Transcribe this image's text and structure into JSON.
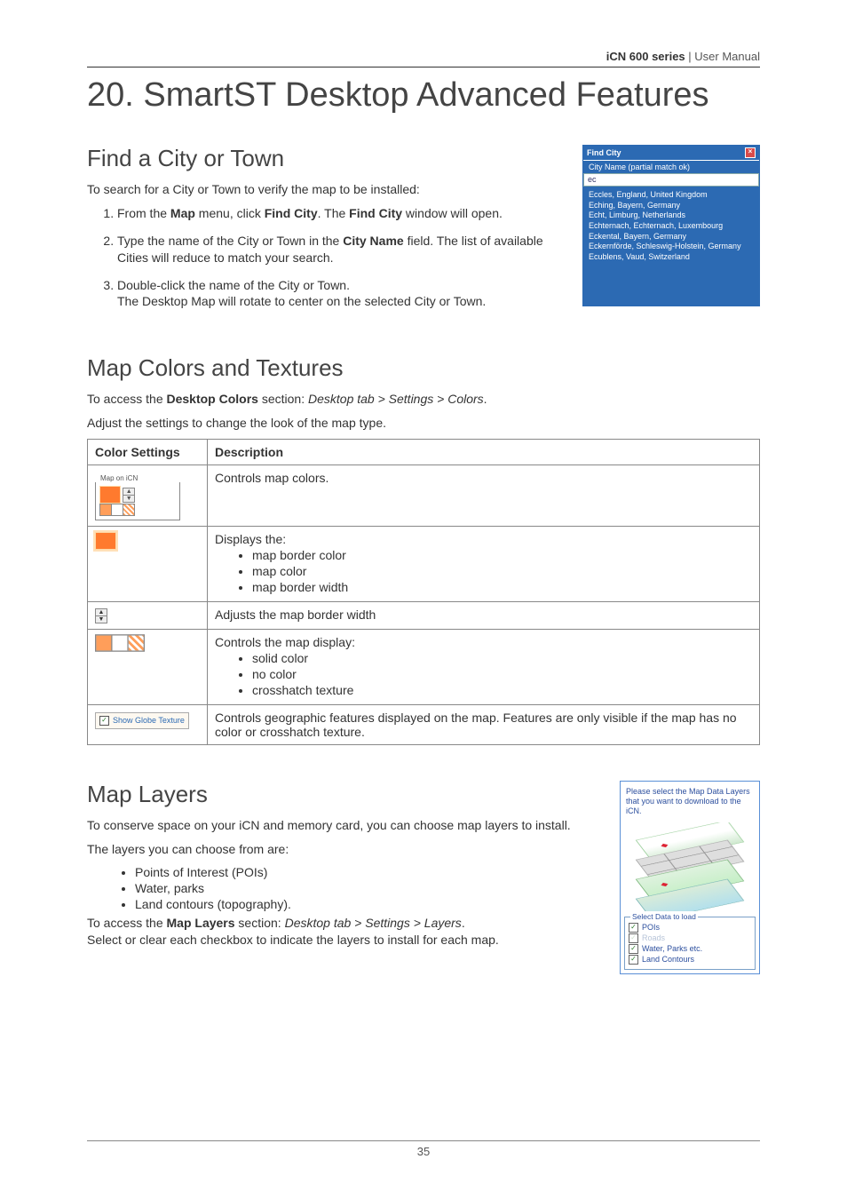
{
  "header": {
    "product": "iCN 600 series",
    "doc": "User Manual"
  },
  "chapter_title": "20. SmartST Desktop Advanced Features",
  "find_city": {
    "heading": "Find a City or Town",
    "intro": "To search for a City or Town to verify the map to be installed:",
    "steps": [
      {
        "pre": "From the ",
        "b1": "Map",
        "mid": " menu, click ",
        "b2": "Find City",
        "mid2": ". The ",
        "b3": "Find City",
        "post": " window will open."
      },
      {
        "pre": "Type the name of the City or Town in the ",
        "b1": "City Name",
        "post": " field. The list of available Cities will reduce to match your search."
      },
      {
        "pre": "Double-click the name of the City or Town.",
        "post2": "The Desktop Map will rotate to center on the selected City or Town."
      }
    ],
    "dialog": {
      "title": "Find City",
      "subtitle": "City Name (partial match ok)",
      "input_value": "ec",
      "results": [
        "Eccles, England, United Kingdom",
        "Eching, Bayern, Germany",
        "Echt, Limburg, Netherlands",
        "Echternach, Echternach, Luxembourg",
        "Eckental, Bayern, Germany",
        "Eckernförde, Schleswig-Holstein, Germany",
        "Ecublens, Vaud, Switzerland"
      ]
    }
  },
  "colors": {
    "heading": "Map Colors and Textures",
    "line1a": "To access the ",
    "line1b": "Desktop Colors",
    "line1c": " section: ",
    "line1d": "Desktop tab > Settings > Colors",
    "line1e": ".",
    "line2": "Adjust the settings to change the look of the map type.",
    "th1": "Color Settings",
    "th2": "Description",
    "row1": "Controls map colors.",
    "row2_head": "Displays the:",
    "row2_items": [
      "map border color",
      "map color",
      "map border width"
    ],
    "row3": "Adjusts the map border width",
    "row4_head": "Controls the map display:",
    "row4_items": [
      "solid color",
      "no color",
      "crosshatch texture"
    ],
    "row5": "Controls geographic features displayed on the map. Features are only visible if the map has no color or crosshatch texture.",
    "map_icn_legend": "Map on iCN",
    "show_globe": "Show Globe Texture"
  },
  "layers": {
    "heading": "Map Layers",
    "p1": "To conserve space on your iCN and memory card, you can choose map layers to install.",
    "p2": "The layers you can choose from are:",
    "items": [
      "Points of Interest (POIs)",
      "Water, parks",
      "Land contours (topography)."
    ],
    "p3a": "To access the ",
    "p3b": "Map Layers",
    "p3c": " section: ",
    "p3d": "Desktop tab > Settings > Layers",
    "p3e": ".",
    "p4": "Select or clear each checkbox to indicate the layers to install for each map.",
    "panel": {
      "text": "Please select the Map Data Layers that you want to download to the iCN.",
      "legend": "Select Data to load",
      "rows": [
        {
          "label": "POIs",
          "checked": true,
          "disabled": false
        },
        {
          "label": "Roads",
          "checked": true,
          "disabled": true
        },
        {
          "label": "Water, Parks etc.",
          "checked": true,
          "disabled": false
        },
        {
          "label": "Land Contours",
          "checked": true,
          "disabled": false
        }
      ]
    }
  },
  "page_number": "35"
}
